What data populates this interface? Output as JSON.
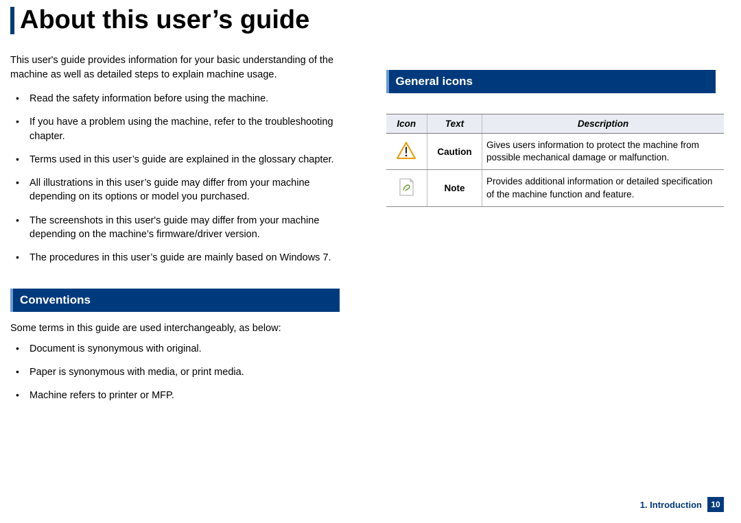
{
  "title": "About this user’s guide",
  "intro": "This user's guide provides information for your basic understanding of the machine as well as detailed steps to explain machine usage.",
  "bullets_main": [
    "Read the safety information before using the machine.",
    "If you have a problem using the machine, refer to the troubleshooting chapter.",
    "Terms used in this user’s guide are explained in the glossary chapter.",
    "All illustrations in this user’s guide may differ from your machine depending on its options or model you purchased.",
    "The screenshots in this user's guide may differ from your machine depending on the machine’s firmware/driver version.",
    "The procedures in this user’s guide are mainly based on Windows 7."
  ],
  "conventions": {
    "heading": "Conventions",
    "intro": "Some terms in this guide are used interchangeably, as below:",
    "items": [
      "Document is synonymous with original.",
      "Paper is synonymous with media, or print media.",
      "Machine refers to printer or MFP."
    ]
  },
  "general_icons": {
    "heading": "General icons",
    "columns": {
      "icon": "Icon",
      "text": "Text",
      "desc": "Description"
    },
    "rows": [
      {
        "icon": "caution",
        "text": "Caution",
        "desc": "Gives users information to protect the machine from possible mechanical damage or malfunction."
      },
      {
        "icon": "note",
        "text": "Note",
        "desc": "Provides additional information or detailed specification of the machine function and feature."
      }
    ]
  },
  "footer": {
    "chapter": "1. Introduction",
    "page": "10"
  }
}
